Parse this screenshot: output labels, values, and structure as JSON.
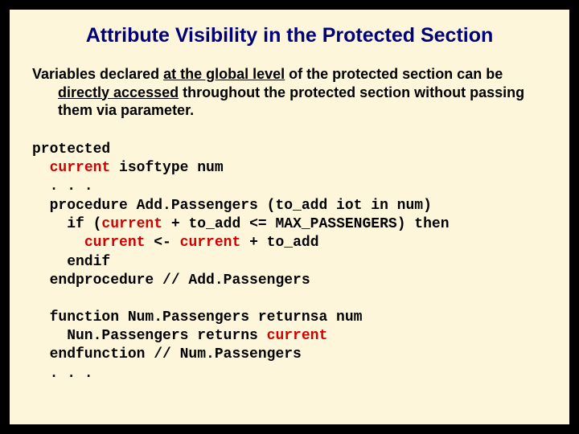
{
  "title": "Attribute Visibility in the Protected Section",
  "body": {
    "p1a": "Variables declared ",
    "p1_u1": "at the global level",
    "p1b": " of the protected section can be ",
    "p1_u2": "directly accessed",
    "p1c": " throughout the protected section without passing them via parameter."
  },
  "code1": {
    "l1": "protected",
    "l2a": "  ",
    "l2b": "current",
    "l2c": " isoftype num",
    "l3": "  . . .",
    "l4": "  procedure Add.Passengers (to_add iot in num)",
    "l5a": "    if (",
    "l5b": "current",
    "l5c": " + to_add <= MAX_PASSENGERS) then",
    "l6a": "      ",
    "l6b": "current",
    "l6c": " <- ",
    "l6d": "current",
    "l6e": " + to_add",
    "l7": "    endif",
    "l8": "  endprocedure // Add.Passengers"
  },
  "code2": {
    "l1": "  function Num.Passengers returnsa num",
    "l2a": "    Nun.Passengers returns ",
    "l2b": "current",
    "l3": "  endfunction // Num.Passengers",
    "l4": "  . . ."
  }
}
